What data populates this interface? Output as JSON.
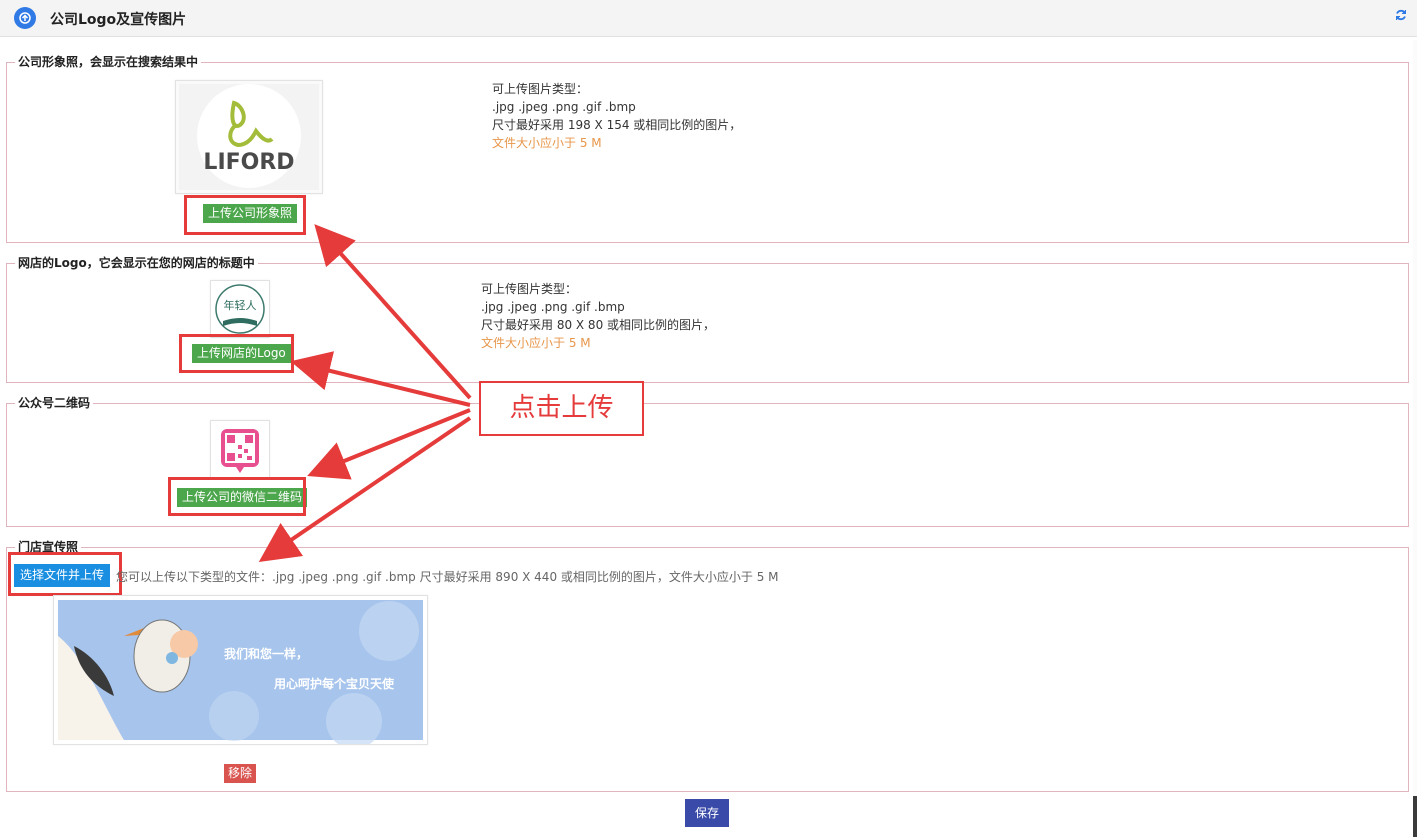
{
  "header": {
    "title": "公司Logo及宣传图片",
    "refresh_icon": "refresh-icon",
    "nav_icon": "circle-arrow-up-icon"
  },
  "section1": {
    "legend": "公司形象照，会显示在搜索结果中",
    "upload_button": "上传公司形象照",
    "logo_text": "LIFORD",
    "info": {
      "line1": "可上传图片类型：",
      "line2": ".jpg .jpeg .png .gif .bmp",
      "line3": "尺寸最好采用 198 X 154 或相同比例的图片，",
      "line4": "文件大小应小于 5 M"
    }
  },
  "section2": {
    "legend": "网店的Logo，它会显示在您的网店的标题中",
    "upload_button": "上传网店的Logo",
    "logo_text": "年轻人",
    "info": {
      "line1": "可上传图片类型：",
      "line2": ".jpg .jpeg .png .gif .bmp",
      "line3": "尺寸最好采用 80 X 80 或相同比例的图片，",
      "line4": "文件大小应小于 5 M"
    }
  },
  "section3": {
    "legend": "公众号二维码",
    "upload_button": "上传公司的微信二维码"
  },
  "section4": {
    "legend": "门店宣传照",
    "upload_button": "选择文件并上传",
    "hint": "您可以上传以下类型的文件：.jpg .jpeg .png .gif .bmp 尺寸最好采用 890 X 440 或相同比例的图片，文件大小应小于 5 M",
    "banner_line1": "我们和您一样，",
    "banner_line2": "用心呵护每个宝贝天使",
    "remove_button": "移除"
  },
  "save_button": "保存",
  "callout": "点击上传",
  "colors": {
    "accent_blue": "#2f7ae5",
    "green": "#4ca64c",
    "annotation_red": "#e53b3b",
    "orange": "#e7964a",
    "save_blue": "#3a4aa8",
    "remove_red": "#d9534f"
  }
}
